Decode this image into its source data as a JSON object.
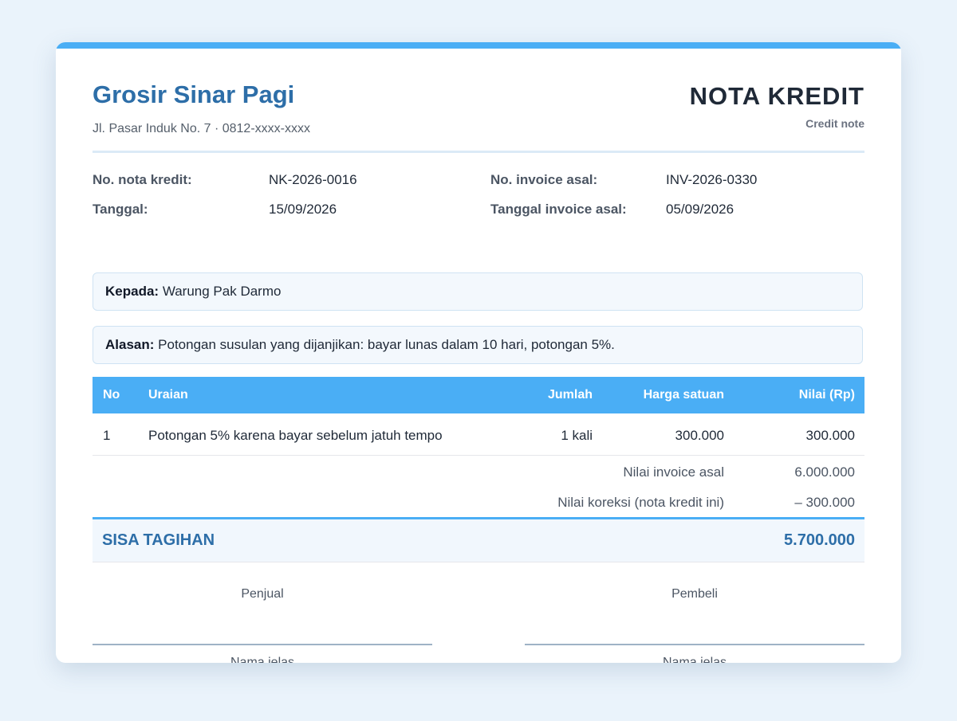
{
  "seller": {
    "name": "Grosir Sinar Pagi",
    "address": "Jl. Pasar Induk No. 7 · 0812-xxxx-xxxx"
  },
  "document": {
    "title": "NOTA KREDIT",
    "subtitle": "Credit note"
  },
  "meta": {
    "credit_no_label": "No. nota kredit:",
    "credit_no": "NK-2026-0016",
    "date_label": "Tanggal:",
    "date": "15/09/2026",
    "invoice_no_label": "No. invoice asal:",
    "invoice_no": "INV-2026-0330",
    "invoice_date_label": "Tanggal invoice asal:",
    "invoice_date": "05/09/2026"
  },
  "recipient": {
    "label": "Kepada:",
    "name": "Warung Pak Darmo"
  },
  "reason": {
    "label": "Alasan:",
    "text": "Potongan susulan yang dijanjikan: bayar lunas dalam 10 hari, potongan 5%."
  },
  "table": {
    "headers": {
      "no": "No",
      "description": "Uraian",
      "qty": "Jumlah",
      "unit_price": "Harga satuan",
      "amount": "Nilai (Rp)"
    },
    "rows": [
      {
        "no": "1",
        "description": "Potongan 5% karena bayar sebelum jatuh tempo",
        "qty": "1 kali",
        "unit_price": "300.000",
        "amount": "300.000"
      }
    ]
  },
  "summary": {
    "original_label": "Nilai invoice asal",
    "original_value": "6.000.000",
    "correction_label": "Nilai koreksi (nota kredit ini)",
    "correction_value": "– 300.000",
    "total_label": "SISA TAGIHAN",
    "total_value": "5.700.000"
  },
  "signatures": {
    "seller_label": "Penjual",
    "buyer_label": "Pembeli",
    "seller_name_label": "Nama jelas",
    "buyer_name_label": "Nama jelas"
  },
  "colors": {
    "accent": "#4aaef5",
    "brand": "#2d6ea8",
    "background": "#eaf3fb"
  }
}
